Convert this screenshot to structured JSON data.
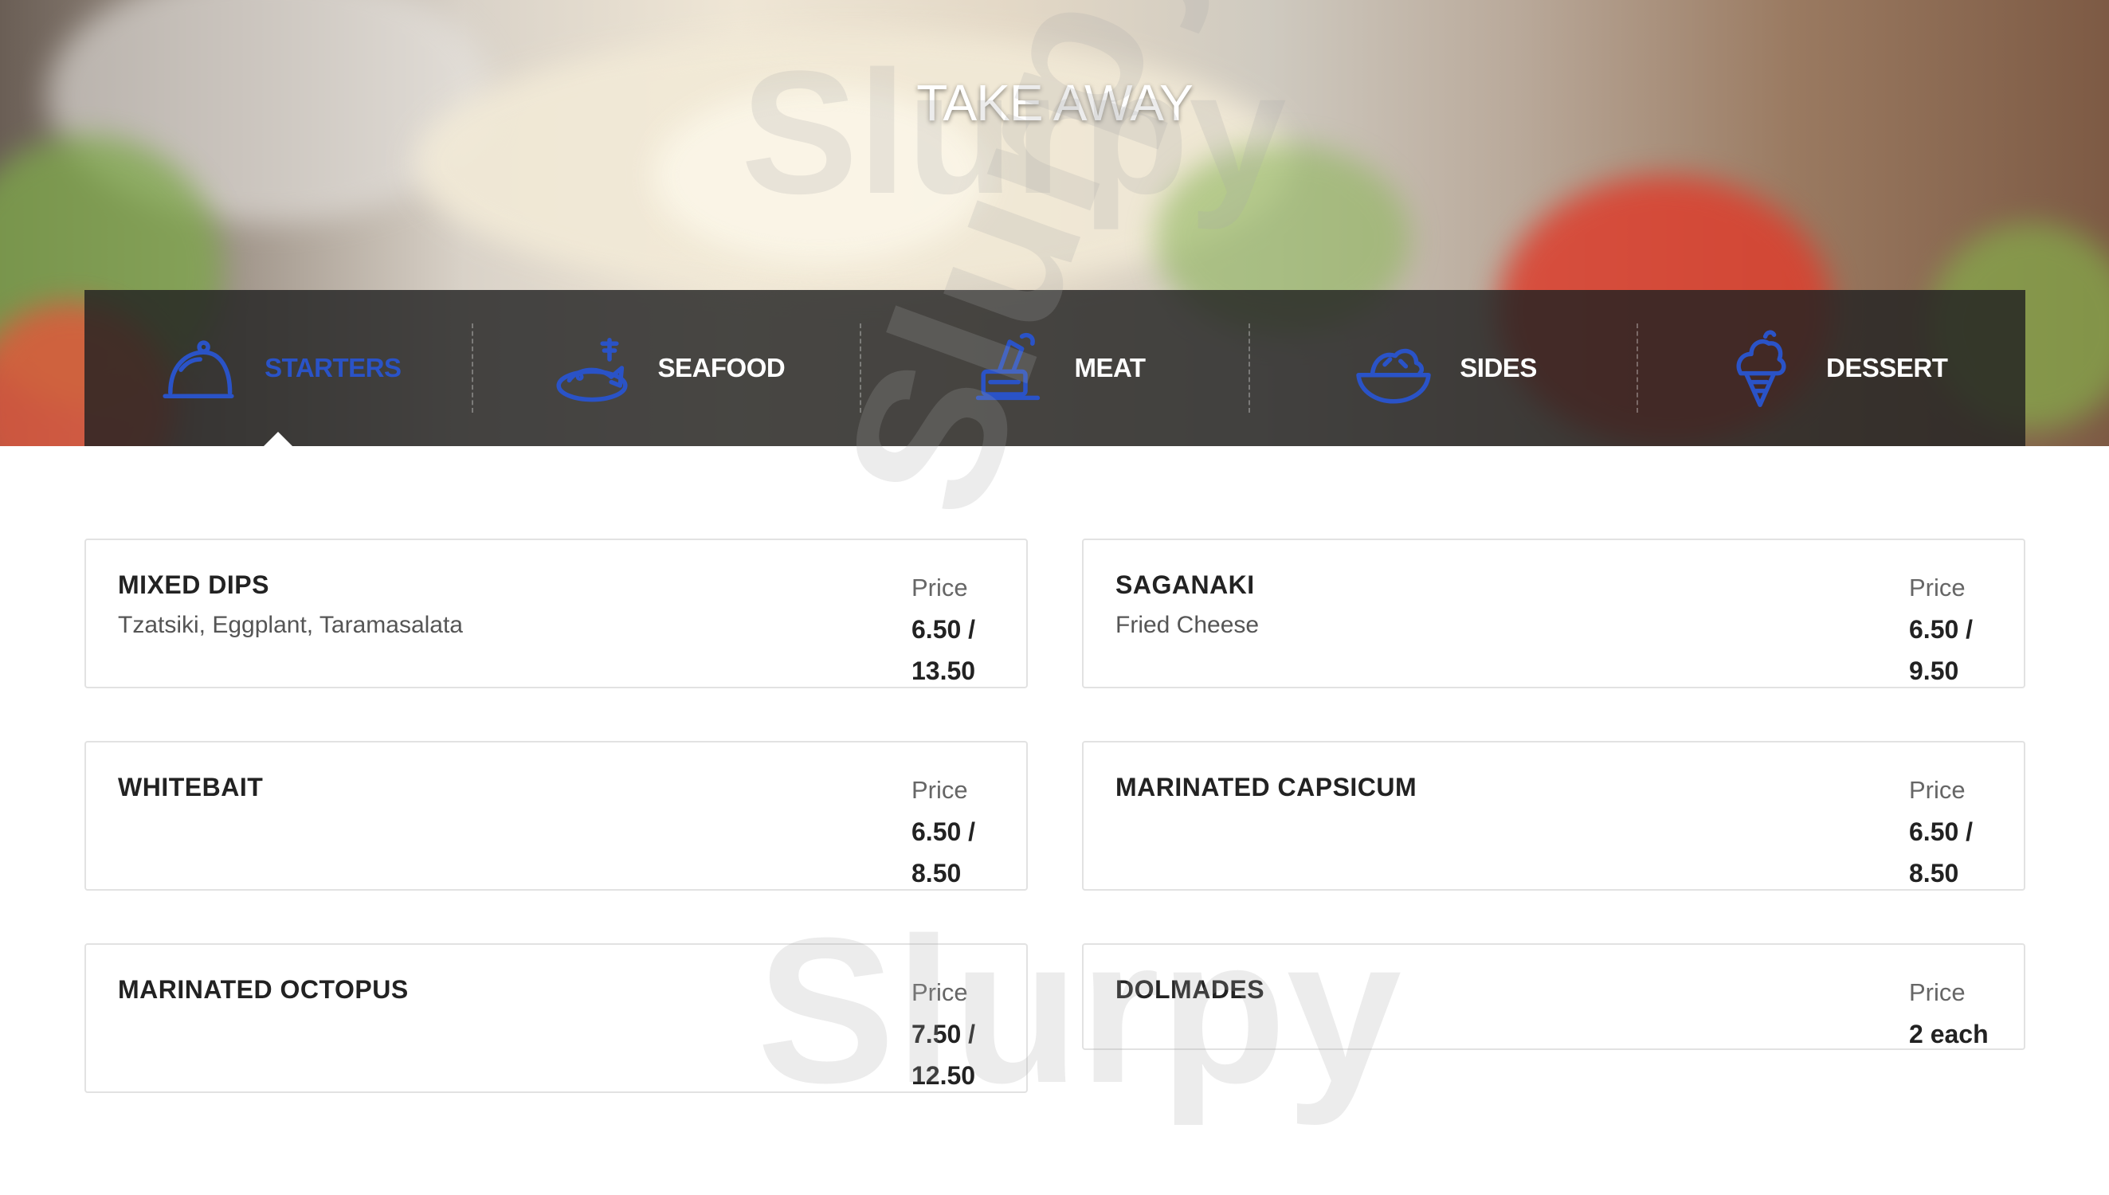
{
  "hero": {
    "title": "TAKE AWAY"
  },
  "watermark": {
    "text": "Slurpy"
  },
  "tabs": [
    {
      "label": "STARTERS",
      "icon": "cloche-icon",
      "active": true
    },
    {
      "label": "SEAFOOD",
      "icon": "fish-plate-icon",
      "active": false
    },
    {
      "label": "MEAT",
      "icon": "chef-grill-icon",
      "active": false
    },
    {
      "label": "SIDES",
      "icon": "salad-bowl-icon",
      "active": false
    },
    {
      "label": "DESSERT",
      "icon": "ice-cream-icon",
      "active": false
    }
  ],
  "colors": {
    "accent": "#2a53c7",
    "nav_background": "#222222",
    "text": "#222222"
  },
  "menu": {
    "price_label": "Price",
    "items": [
      {
        "name": "MIXED DIPS",
        "description": "Tzatsiki, Eggplant, Taramasalata",
        "price_line1": "6.50 /",
        "price_line2": "13.50"
      },
      {
        "name": "SAGANAKI",
        "description": "Fried Cheese",
        "price_line1": "6.50 /",
        "price_line2": "9.50"
      },
      {
        "name": "WHITEBAIT",
        "description": "",
        "price_line1": "6.50 /",
        "price_line2": "8.50"
      },
      {
        "name": "MARINATED CAPSICUM",
        "description": "",
        "price_line1": "6.50 /",
        "price_line2": "8.50"
      },
      {
        "name": "MARINATED OCTOPUS",
        "description": "",
        "price_line1": "7.50 /",
        "price_line2": "12.50"
      },
      {
        "name": "DOLMADES",
        "description": "",
        "price_line1": "2 each",
        "price_line2": ""
      }
    ]
  }
}
